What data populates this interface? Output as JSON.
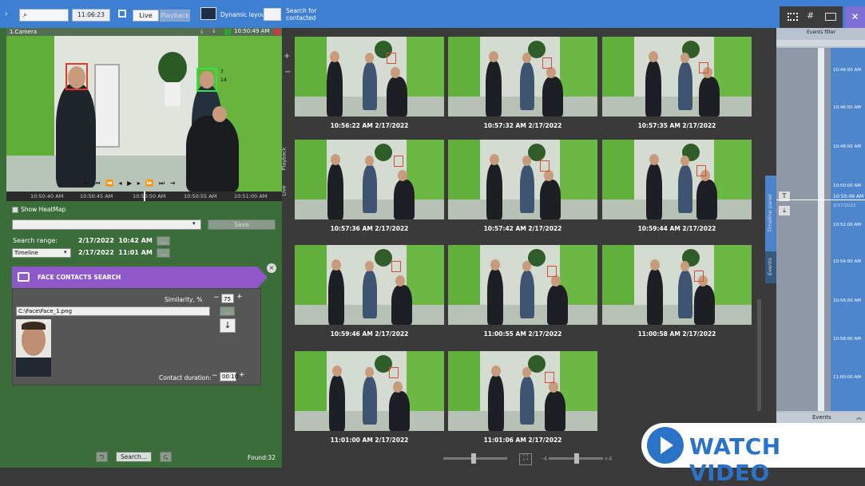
{
  "topbar": {
    "search_placeholder": "",
    "time": "11:06:23",
    "live_label": "Live",
    "playback_label": "Playback",
    "dynamic_layout": "Dynamic layout",
    "search_for_contacted": "Search for\ncontacted"
  },
  "camera": {
    "title": "1.Camera",
    "timestamp": "10:50:49 AM",
    "timeline_ticks": [
      "10:50:40 AM",
      "10:50:45 AM",
      "10:50:50 AM",
      "10:50:55 AM",
      "10:51:00 AM"
    ],
    "face_labels": [
      "7",
      "14"
    ]
  },
  "side_tabs": {
    "playback": "Playback",
    "live": "Live"
  },
  "controls": {
    "show_heatmap": "Show HeatMap",
    "save_label": "Save",
    "search_range_label": "Search range:",
    "range_start": "2/17/2022  10:42 AM",
    "range_end": "2/17/2022  11:01 AM",
    "timeline_select": "Timeline",
    "ellipsis": "..."
  },
  "face_search": {
    "title": "FACE CONTACTS SEARCH",
    "similarity_label": "Similarity, %",
    "similarity_value": "75",
    "file_path": "C:\\Face\\Face_1.png",
    "contact_duration_label": "Contact duration:",
    "contact_duration_value": "00:10",
    "search_button": "Search...",
    "found": "Found:32"
  },
  "results": [
    {
      "ts": "10:56:22 AM 2/17/2022"
    },
    {
      "ts": "10:57:32 AM 2/17/2022"
    },
    {
      "ts": "10:57:35 AM 2/17/2022"
    },
    {
      "ts": "10:57:36 AM 2/17/2022"
    },
    {
      "ts": "10:57:42 AM 2/17/2022"
    },
    {
      "ts": "10:59:44 AM 2/17/2022"
    },
    {
      "ts": "10:59:46 AM 2/17/2022"
    },
    {
      "ts": "11:00:55 AM 2/17/2022"
    },
    {
      "ts": "11:00:58 AM 2/17/2022"
    },
    {
      "ts": "11:01:00 AM 2/17/2022"
    },
    {
      "ts": "11:01:06 AM 2/17/2022"
    }
  ],
  "right_panel": {
    "events_filter": "Events filter",
    "timeline_panel_tab": "Timeline panel",
    "events_tab": "Events",
    "events_footer": "Events",
    "current_time": "10:50:49 AM",
    "current_date": "2/17/2022",
    "times": [
      "10:44:00 AM",
      "10:46:00 AM",
      "10:48:00 AM",
      "10:50:00 AM",
      "10:52:00 AM",
      "10:54:00 AM",
      "10:56:00 AM",
      "10:58:00 AM",
      "11:00:00 AM"
    ]
  },
  "bottom": {
    "zoom_min": "-4",
    "zoom_max": "+4"
  },
  "overlay": {
    "watch_video": "WATCH VIDEO"
  },
  "colors": {
    "topbar": "#3d7fd0",
    "panel_green": "#3b6d3b",
    "face_purple": "#8f58c9",
    "accent_blue": "#4d86cc"
  }
}
